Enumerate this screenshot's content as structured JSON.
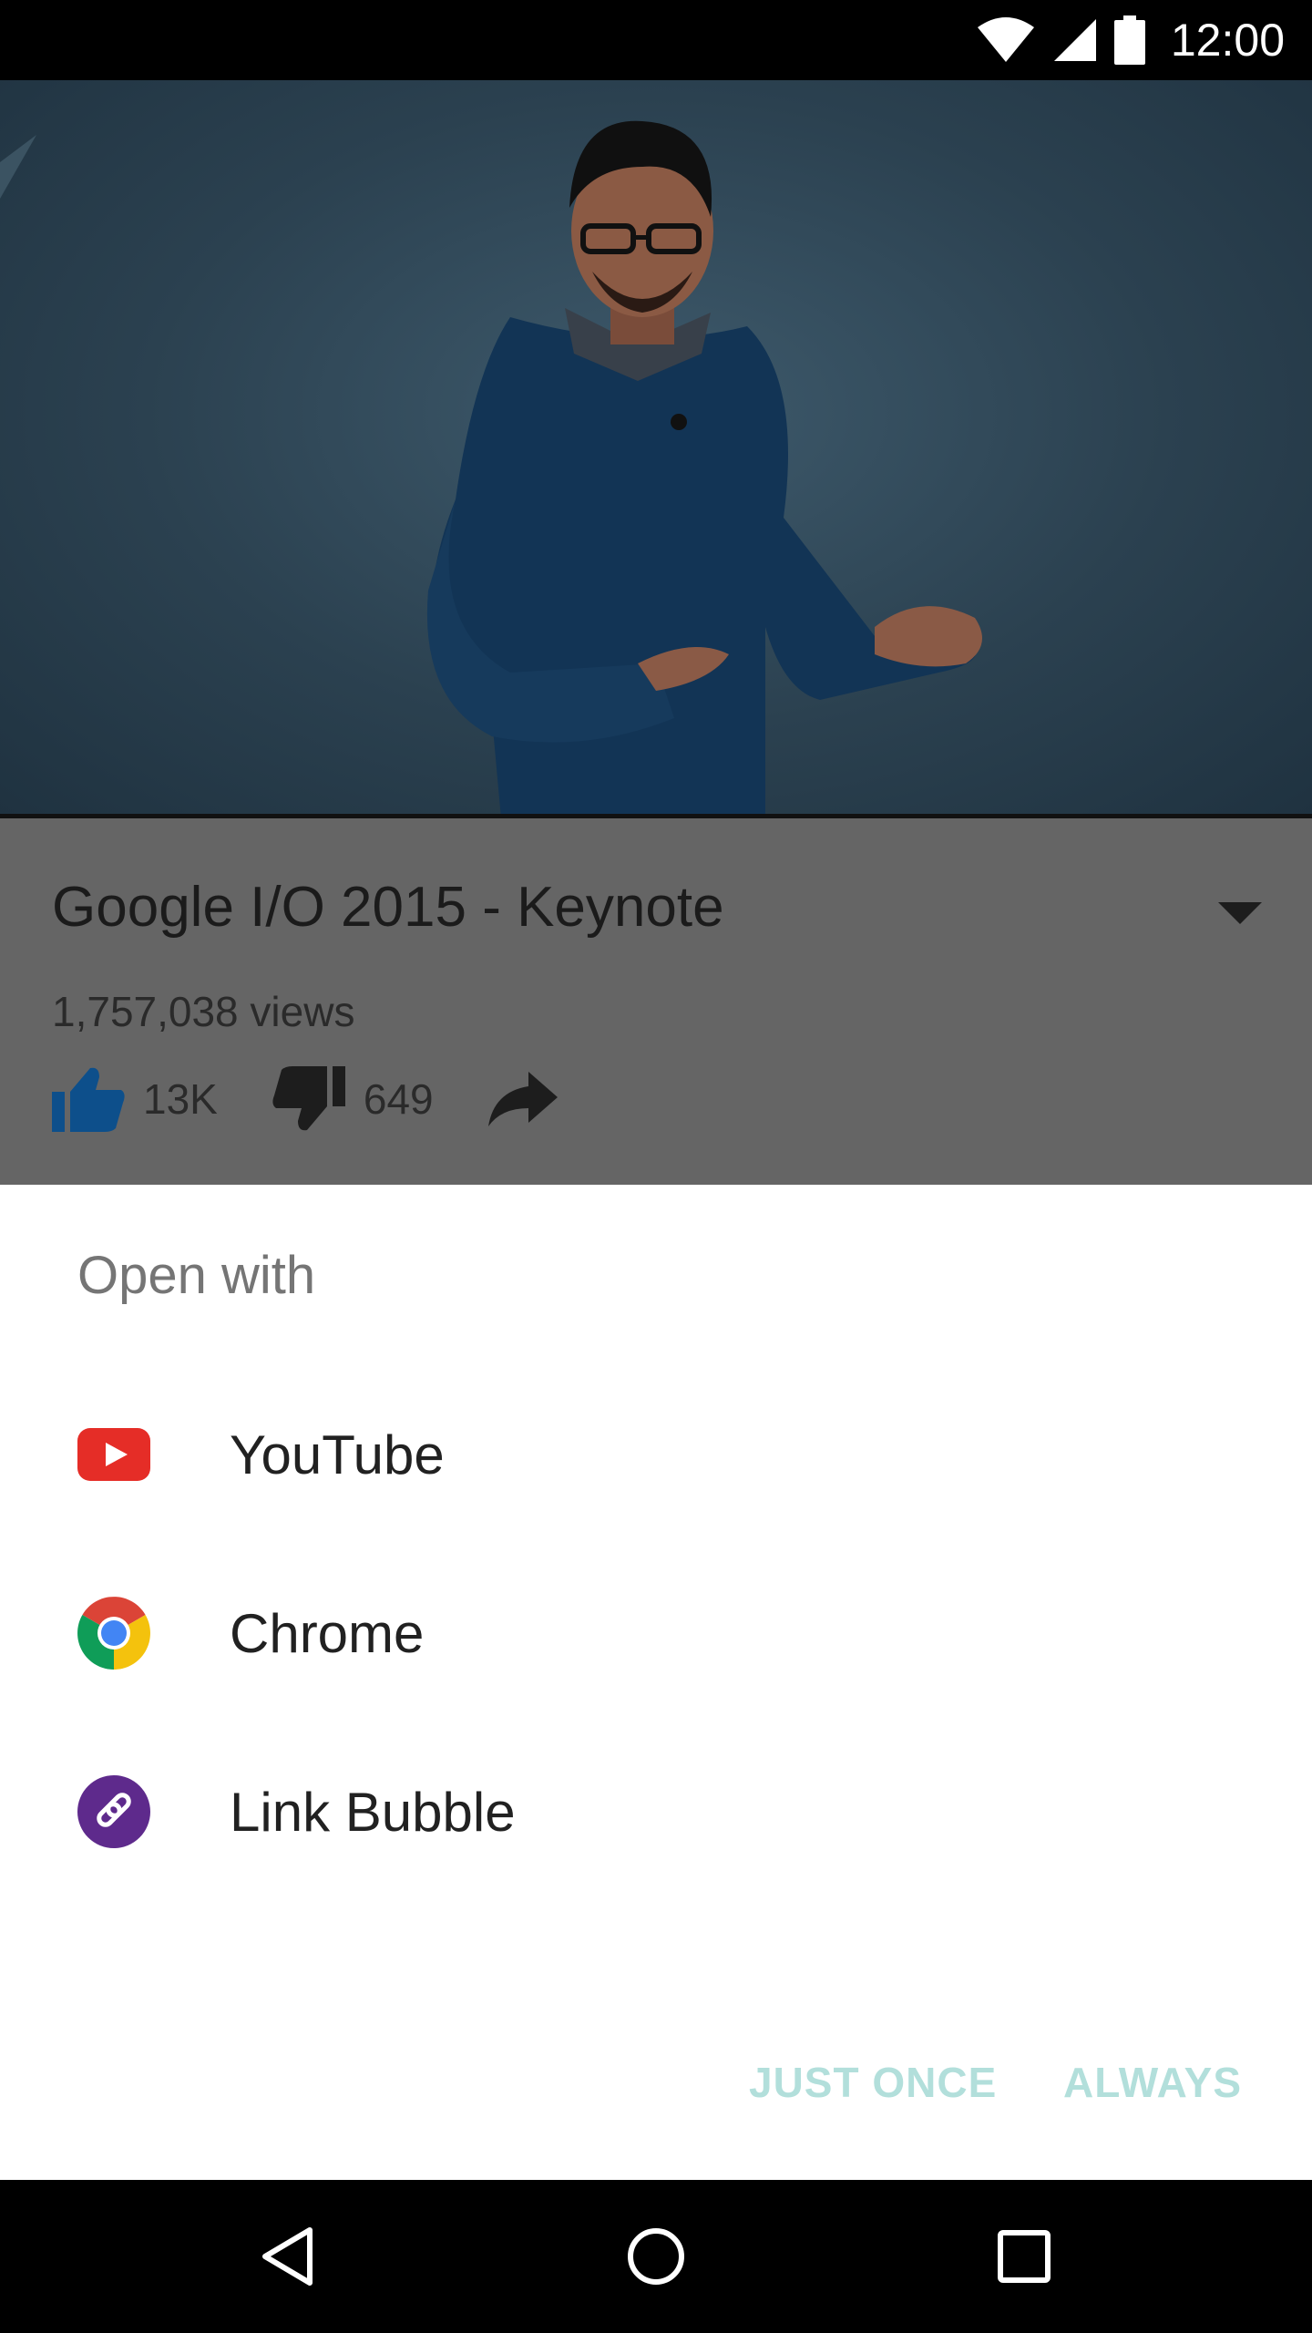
{
  "status_bar": {
    "time": "12:00",
    "icons": [
      "wifi-icon",
      "cellular-signal-icon",
      "battery-icon"
    ]
  },
  "video_page": {
    "title": "Google I/O 2015 - Keynote",
    "views": "1,757,038 views",
    "likes": "13K",
    "dislikes": "649",
    "icons": [
      "thumbs-up-icon",
      "thumbs-down-icon",
      "share-icon",
      "expand-arrow-icon"
    ],
    "like_color": "#0d4f8b"
  },
  "chooser": {
    "title": "Open with",
    "apps": [
      {
        "label": "YouTube",
        "icon": "youtube-icon"
      },
      {
        "label": "Chrome",
        "icon": "chrome-icon"
      },
      {
        "label": "Link Bubble",
        "icon": "link-bubble-icon"
      }
    ],
    "buttons": {
      "just_once": "JUST ONCE",
      "always": "ALWAYS"
    },
    "button_color": "#b2dfdb"
  },
  "nav_bar": {
    "icons": [
      "back-icon",
      "home-icon",
      "recents-icon"
    ]
  }
}
